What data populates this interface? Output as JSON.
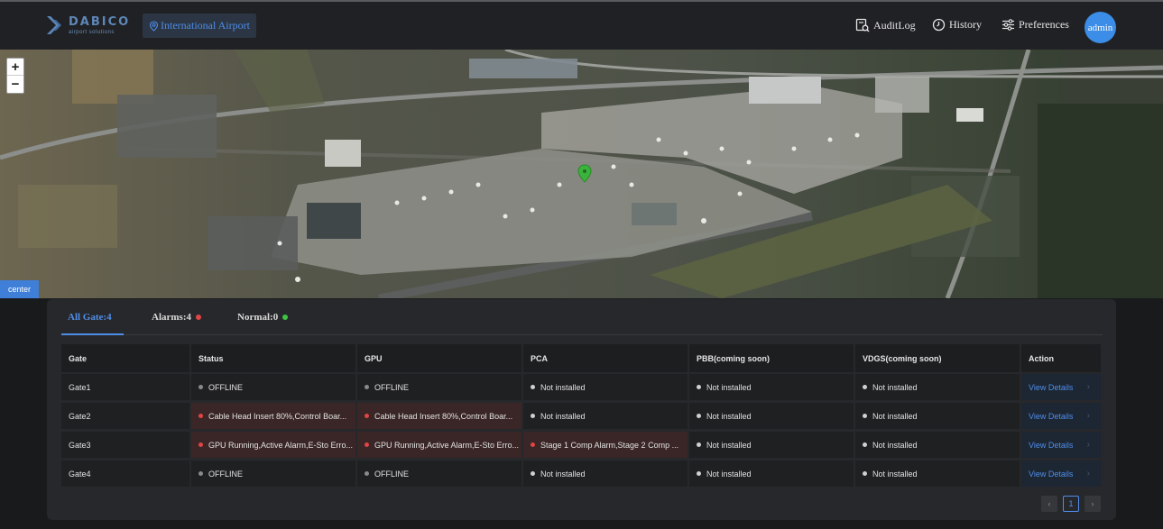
{
  "header": {
    "logo_name": "DABICO",
    "logo_sub": "airport solutions",
    "airport": "International Airport",
    "nav": [
      {
        "label": "AuditLog",
        "icon": "audit-log-icon"
      },
      {
        "label": "History",
        "icon": "clock-icon"
      },
      {
        "label": "Preferences",
        "icon": "sliders-icon"
      }
    ],
    "user": "admin"
  },
  "map": {
    "zoom_in": "+",
    "zoom_out": "−",
    "center_label": "center",
    "marker_color": "#3bb23b"
  },
  "tabs": [
    {
      "label": "All Gate:4",
      "active": true
    },
    {
      "label": "Alarms:4",
      "dot_color": "#e04545"
    },
    {
      "label": "Normal:0",
      "dot_color": "#3fc246"
    }
  ],
  "table": {
    "columns": [
      "Gate",
      "Status",
      "GPU",
      "PCA",
      "PBB(coming soon)",
      "VDGS(coming soon)",
      "Action"
    ],
    "rows": [
      {
        "gate": "Gate1",
        "status": {
          "text": "OFFLINE",
          "state": "offline"
        },
        "gpu": {
          "text": "OFFLINE",
          "state": "offline"
        },
        "pca": {
          "text": "Not installed",
          "state": "none"
        },
        "pbb": {
          "text": "Not installed",
          "state": "none"
        },
        "vdgs": {
          "text": "Not installed",
          "state": "none"
        },
        "action": "View Details"
      },
      {
        "gate": "Gate2",
        "status": {
          "text": "Cable Head Insert 80%,Control Boar...",
          "state": "alarm"
        },
        "gpu": {
          "text": "Cable Head Insert 80%,Control Boar...",
          "state": "alarm"
        },
        "pca": {
          "text": "Not installed",
          "state": "none"
        },
        "pbb": {
          "text": "Not installed",
          "state": "none"
        },
        "vdgs": {
          "text": "Not installed",
          "state": "none"
        },
        "action": "View Details"
      },
      {
        "gate": "Gate3",
        "status": {
          "text": "GPU Running,Active Alarm,E-Sto Erro...",
          "state": "alarm"
        },
        "gpu": {
          "text": "GPU Running,Active Alarm,E-Sto Erro...",
          "state": "alarm"
        },
        "pca": {
          "text": "Stage 1 Comp Alarm,Stage 2 Comp ...",
          "state": "alarm"
        },
        "pbb": {
          "text": "Not installed",
          "state": "none"
        },
        "vdgs": {
          "text": "Not installed",
          "state": "none"
        },
        "action": "View Details"
      },
      {
        "gate": "Gate4",
        "status": {
          "text": "OFFLINE",
          "state": "offline"
        },
        "gpu": {
          "text": "OFFLINE",
          "state": "offline"
        },
        "pca": {
          "text": "Not installed",
          "state": "none"
        },
        "pbb": {
          "text": "Not installed",
          "state": "none"
        },
        "vdgs": {
          "text": "Not installed",
          "state": "none"
        },
        "action": "View Details"
      }
    ]
  },
  "pagination": {
    "prev": "‹",
    "current": "1",
    "next": "›"
  },
  "colors": {
    "accent": "#4f8ee8",
    "alarm_dot": "#e04545",
    "offline_dot": "#8a8a8a",
    "none_dot": "#d0d0d0",
    "alarm_bg": "#3a2626"
  }
}
